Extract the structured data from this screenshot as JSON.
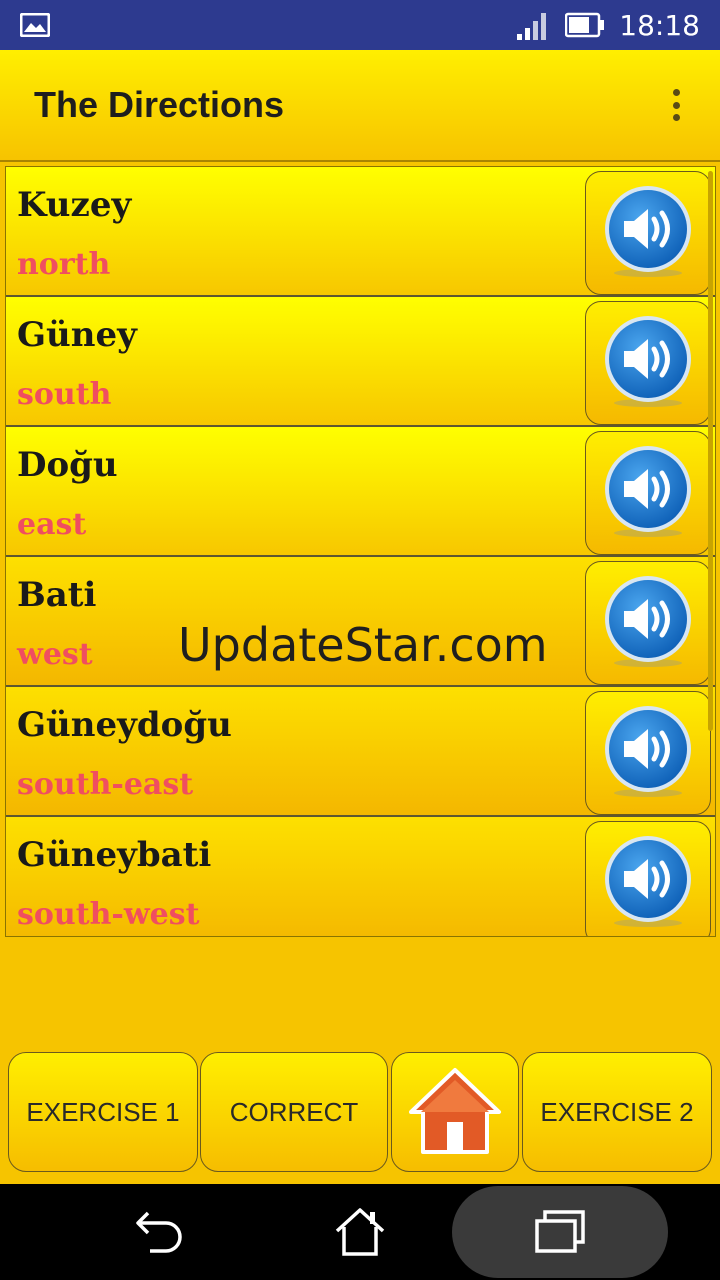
{
  "status_bar": {
    "time": "18:18",
    "icons": [
      "gallery-icon",
      "signal-icon",
      "battery-icon"
    ]
  },
  "app_bar": {
    "title": "The Directions",
    "menu_icon": "overflow-menu-icon"
  },
  "words": [
    {
      "tr": "Kuzey",
      "en": "north"
    },
    {
      "tr": "Güney",
      "en": "south"
    },
    {
      "tr": "Doğu",
      "en": "east"
    },
    {
      "tr": "Bati",
      "en": "west"
    },
    {
      "tr": "Güneydoğu",
      "en": "south-east"
    },
    {
      "tr": "Güneybati",
      "en": "south-west"
    }
  ],
  "watermark": "UpdateStar.com",
  "bottom_buttons": {
    "exercise1": "EXERCISE 1",
    "correct": "CORRECT",
    "home_icon": "home-icon",
    "exercise2": "EXERCISE 2"
  },
  "nav_bar": {
    "icons": [
      "back-icon",
      "home-nav-icon",
      "recents-icon"
    ]
  },
  "colors": {
    "status_bar": "#2d3a8f",
    "primary_yellow": "#ffef00",
    "english_text": "#f04e60",
    "sound_blue": "#1b6fc4"
  }
}
